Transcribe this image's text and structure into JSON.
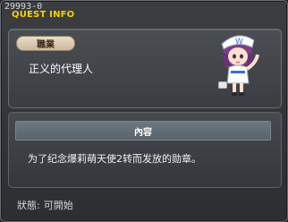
{
  "window": {
    "id_text": "29993-0",
    "title": "QUEST INFO"
  },
  "job": {
    "badge_label": "職業",
    "value": "正义的代理人"
  },
  "content": {
    "header": "內容",
    "text": "为了纪念爆莉萌天使2转而发放的勋章。"
  },
  "status": {
    "label": "狀態:",
    "value": "可開始"
  },
  "colors": {
    "title": "#f2d200",
    "pill": "#e9dcc7",
    "section_header": "#6d7882"
  },
  "icons": {
    "portrait": "npc-portrait-icon"
  }
}
